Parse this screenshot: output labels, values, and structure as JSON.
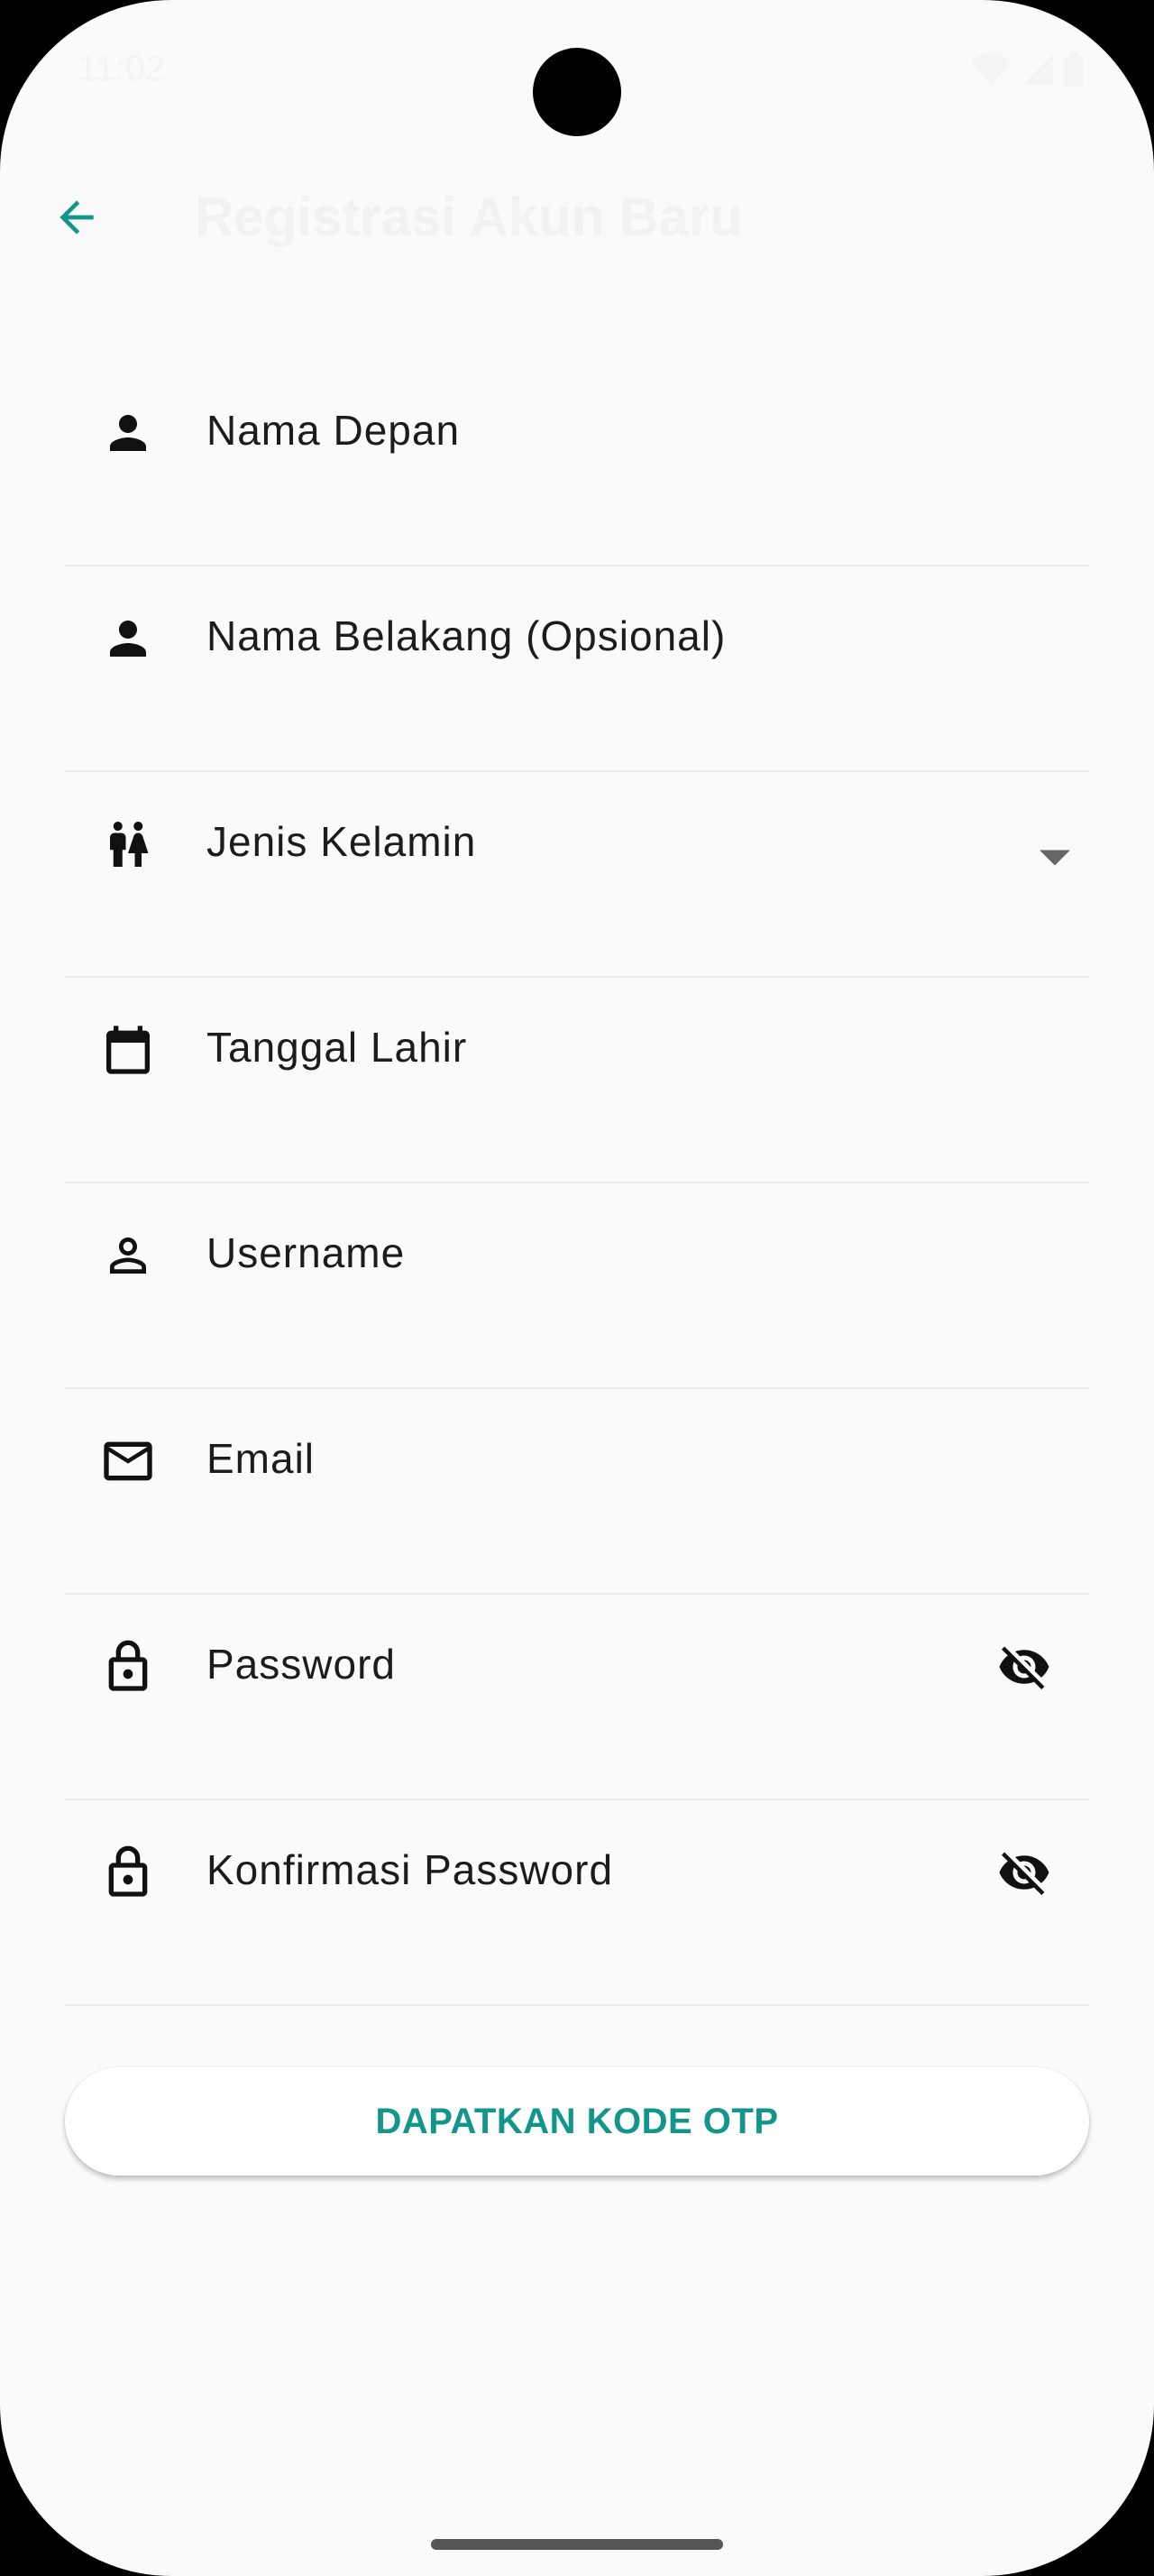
{
  "status_bar": {
    "time": "11:02"
  },
  "app_bar": {
    "back_icon": "arrow-back-icon",
    "title": "Registrasi Akun Baru"
  },
  "form": {
    "fields": [
      {
        "label": "Nama Depan",
        "icon": "person-icon"
      },
      {
        "label": "Nama Belakang (Opsional)",
        "icon": "person-icon"
      },
      {
        "label": "Jenis Kelamin",
        "icon": "wc-icon",
        "trailing": "dropdown-arrow-icon"
      },
      {
        "label": "Tanggal Lahir",
        "icon": "calendar-icon"
      },
      {
        "label": "Username",
        "icon": "person-outline-icon"
      },
      {
        "label": "Email",
        "icon": "mail-icon"
      },
      {
        "label": "Password",
        "icon": "lock-icon",
        "trailing": "visibility-off-icon"
      },
      {
        "label": "Konfirmasi Password",
        "icon": "lock-icon",
        "trailing": "visibility-off-icon"
      }
    ]
  },
  "otp_button": {
    "label": "DAPATKAN KODE OTP"
  },
  "colors": {
    "accent": "#13968a",
    "background": "#fafafa",
    "divider": "#ececec"
  }
}
